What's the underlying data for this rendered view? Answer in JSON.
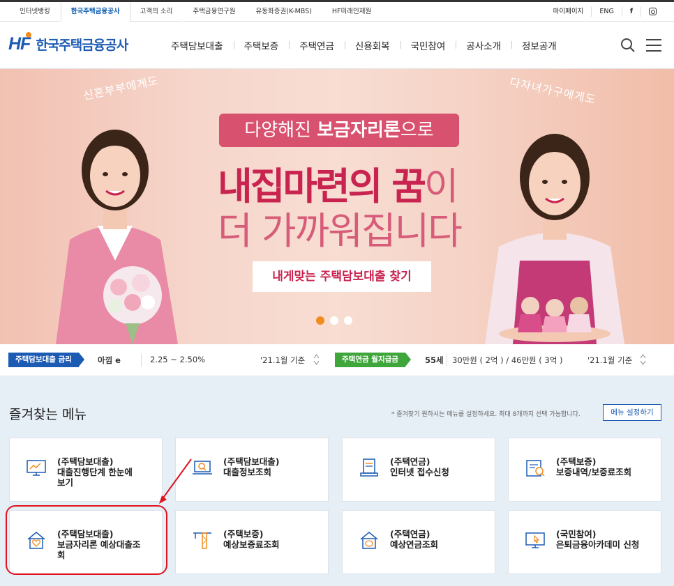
{
  "util_tabs": [
    {
      "label": "인터넷뱅킹",
      "active": false
    },
    {
      "label": "한국주택금융공사",
      "active": true
    },
    {
      "label": "고객의 소리",
      "active": false
    },
    {
      "label": "주택금융연구원",
      "active": false
    },
    {
      "label": "유동화증권(K-MBS)",
      "active": false
    },
    {
      "label": "HF미래인재원",
      "active": false
    }
  ],
  "util_right": {
    "mypage": "마이페이지",
    "eng": "ENG",
    "facebook": "f"
  },
  "logo": {
    "mark": "HF",
    "name": "한국주택금융공사"
  },
  "gnb": [
    "주택담보대출",
    "주택보증",
    "주택연금",
    "신용회복",
    "국민참여",
    "공사소개",
    "정보공개"
  ],
  "hero": {
    "arc_left": "신혼부부에게도",
    "arc_right": "다자녀가구에게도",
    "tag_pre": "다양해진 ",
    "tag_bold": "보금자리론",
    "tag_post": "으로",
    "headline_bold": "내집마련의 꿈",
    "headline_light": "이",
    "headline2": "더 가까워집니다",
    "cta": "내게맞는 주택담보대출 찾기",
    "slide_count": 3,
    "active_slide": 1
  },
  "rates": {
    "loan_label": "주택담보대출 금리",
    "loan_product": "아낌 e",
    "loan_range": "2.25 ~ 2.50%",
    "loan_basis": "'21.1월 기준",
    "pension_label": "주택연금 월지급금",
    "pension_age": "55세",
    "pension_amount": "30만원 ( 2억 ) / 46만원 ( 3억 )",
    "pension_basis": "'21.1월 기준"
  },
  "favorites": {
    "title": "즐겨찾는 메뉴",
    "note": "* 즐겨찾기 원하시는 메뉴를 설정하세요. 최대 8개까지 선택 가능합니다.",
    "settings_button": "메뉴 설정하기",
    "cards": [
      {
        "line1": "(주택담보대출)",
        "line2": "대출진행단계 한눈에",
        "line3": "보기",
        "icon": "monitor-icon"
      },
      {
        "line1": "(주택담보대출)",
        "line2": "대출정보조회",
        "line3": "",
        "icon": "laptop-search-icon"
      },
      {
        "line1": "(주택연금)",
        "line2": "인터넷 접수신청",
        "line3": "",
        "icon": "document-stack-icon"
      },
      {
        "line1": "(주택보증)",
        "line2": "보증내역/보증료조회",
        "line3": "",
        "icon": "calendar-search-icon"
      },
      {
        "line1": "(주택담보대출)",
        "line2": "보금자리론 예상대출조",
        "line3": "회",
        "icon": "house-heart-icon"
      },
      {
        "line1": "(주택보증)",
        "line2": "예상보증료조회",
        "line3": "",
        "icon": "crane-icon"
      },
      {
        "line1": "(주택연금)",
        "line2": "예상연금조회",
        "line3": "",
        "icon": "house-piggy-icon"
      },
      {
        "line1": "(국민참여)",
        "line2": "은퇴금융아카데미 신청",
        "line3": "",
        "icon": "monitor-pointer-icon"
      }
    ]
  },
  "colors": {
    "brand_blue": "#1c5bb4",
    "accent_orange": "#f08c1e",
    "hero_pink": "#c8244f",
    "pension_green": "#3fa63c",
    "annotation_red": "#e0141e"
  }
}
